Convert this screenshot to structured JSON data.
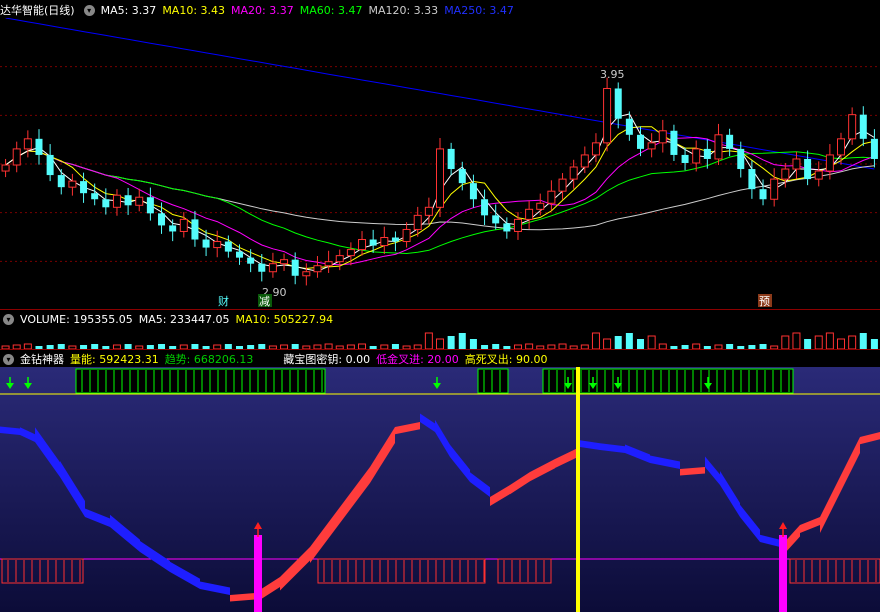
{
  "main_header": {
    "title": "达华智能(日线)",
    "ma5": "MA5: 3.37",
    "ma10": "MA10: 3.43",
    "ma20": "MA20: 3.37",
    "ma60": "MA60: 3.47",
    "ma120": "MA120: 3.33",
    "ma250": "MA250: 3.47"
  },
  "main_labels": {
    "high": "3.95",
    "low": "2.90",
    "tag_cai": "财",
    "tag_jian": "减",
    "tag_yu": "预"
  },
  "volume_header": {
    "volume": "VOLUME: 195355.05",
    "ma5": "MA5: 233447.05",
    "ma10": "MA10: 505227.94"
  },
  "indicator_header": {
    "name": "金钻神器",
    "energy": "量能: 592423.31",
    "trend": "趋势: 668206.13",
    "key": "藏宝图密钥: 0.00",
    "low_cross": "低金叉进: 20.00",
    "high_cross": "高死叉出: 90.00"
  },
  "colors": {
    "ma5": "#ffffff",
    "ma10": "#ffff00",
    "ma20": "#ff00ff",
    "ma60": "#00ff00",
    "ma120": "#cccccc",
    "ma250": "#0000ff",
    "up": "#ff3232",
    "down": "#54fcfc",
    "band_up": "#ff3c3c",
    "band_down": "#1e1eff"
  },
  "chart_data": {
    "type": "candlestick",
    "y_range": [
      2.75,
      4.2
    ],
    "closes": [
      3.47,
      3.55,
      3.6,
      3.52,
      3.42,
      3.36,
      3.39,
      3.33,
      3.3,
      3.26,
      3.32,
      3.27,
      3.31,
      3.23,
      3.17,
      3.14,
      3.2,
      3.1,
      3.06,
      3.09,
      3.04,
      3.01,
      2.98,
      2.94,
      2.98,
      3.0,
      2.92,
      2.94,
      2.97,
      2.99,
      3.02,
      3.05,
      3.1,
      3.07,
      3.11,
      3.09,
      3.15,
      3.22,
      3.26,
      3.55,
      3.45,
      3.38,
      3.3,
      3.22,
      3.18,
      3.14,
      3.2,
      3.25,
      3.28,
      3.34,
      3.4,
      3.46,
      3.52,
      3.58,
      3.85,
      3.7,
      3.62,
      3.55,
      3.58,
      3.64,
      3.52,
      3.48,
      3.55,
      3.5,
      3.62,
      3.55,
      3.45,
      3.35,
      3.3,
      3.4,
      3.45,
      3.5,
      3.4,
      3.44,
      3.52,
      3.6,
      3.72,
      3.6,
      3.5
    ]
  }
}
